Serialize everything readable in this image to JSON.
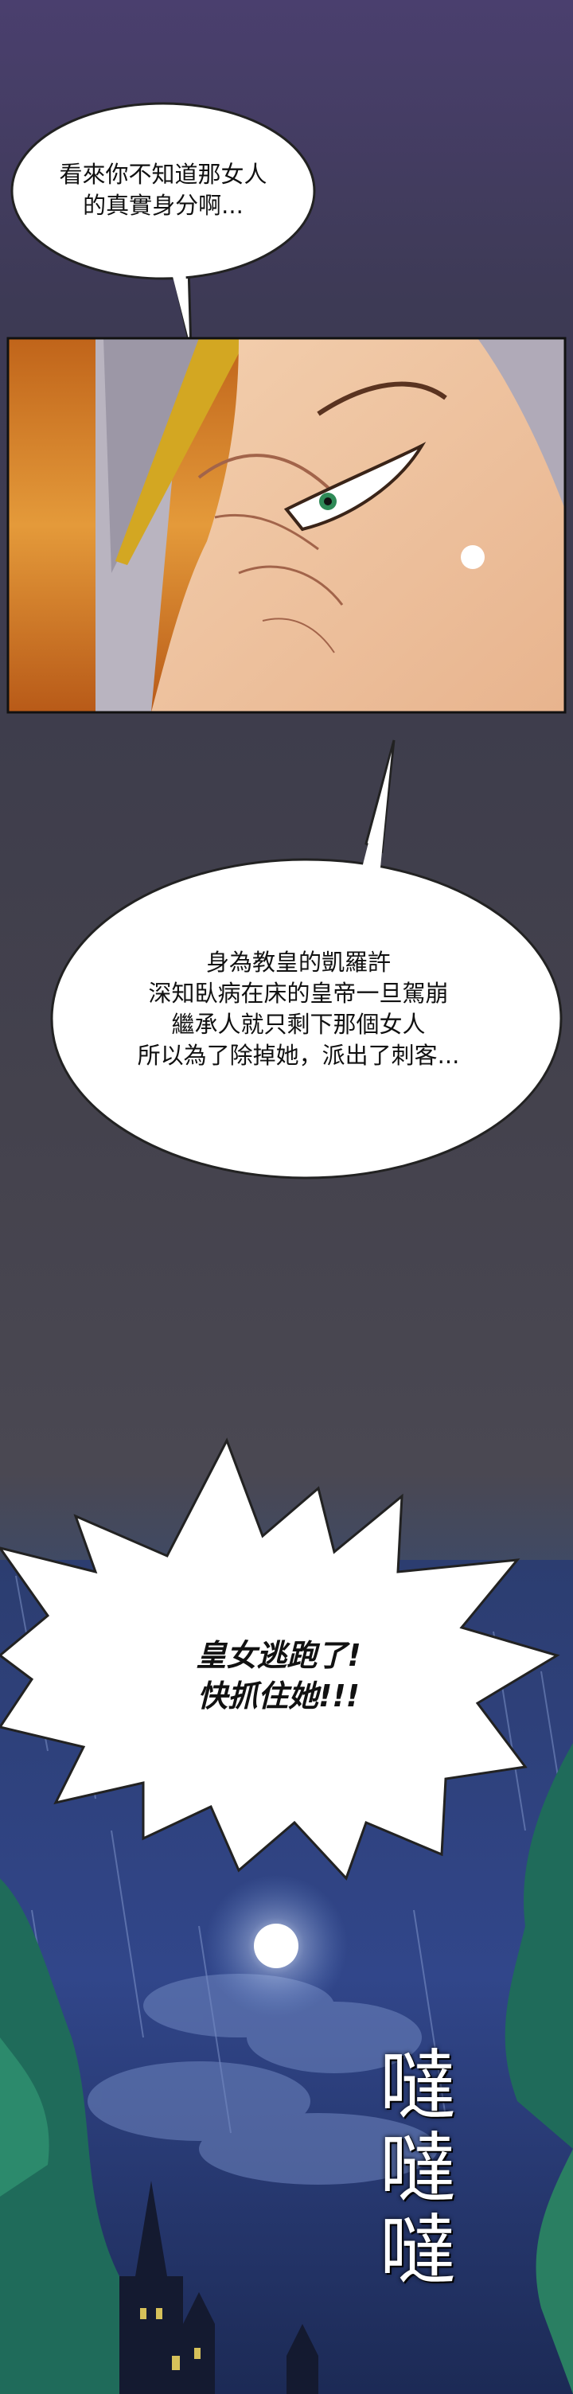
{
  "bubbles": [
    {
      "lines": [
        "看來你不知道那女人",
        "的真實身分啊..."
      ]
    },
    {
      "lines": [
        "身為教皇的凱羅許",
        "深知臥病在床的皇帝一旦駕崩",
        "繼承人就只剩下那個女人",
        "所以為了除掉她，派出了刺客..."
      ]
    },
    {
      "lines": [
        "皇女逃跑了!",
        "快抓住她!!!"
      ]
    }
  ],
  "sfx": {
    "lines": [
      "噠",
      "噠",
      "噠"
    ]
  },
  "colors": {
    "bubble_fill": "#ffffff",
    "bubble_stroke": "#222222",
    "panel_border": "#111111",
    "bg_top": "#4a3f6e",
    "night_sky": "#24386a"
  }
}
